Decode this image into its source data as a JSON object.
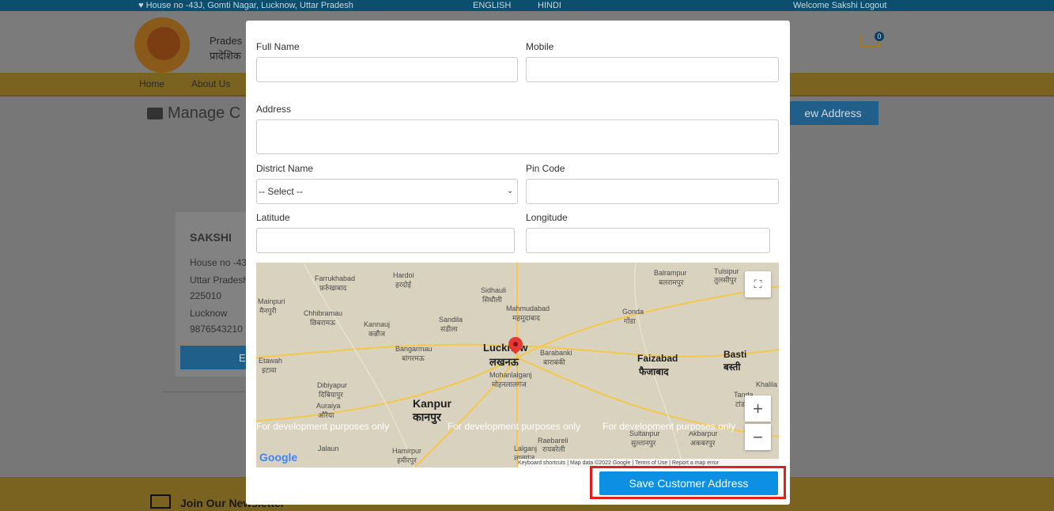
{
  "topbar": {
    "address": "♥ House no -43J, Gomti Nagar, Lucknow, Uttar Pradesh",
    "lang_english": "ENGLISH",
    "lang_hindi": "HINDI",
    "welcome": "Welcome Sakshi Logout"
  },
  "header": {
    "brand_en": "Prades",
    "brand_hi": "प्रादेशिक",
    "cart_count": "0"
  },
  "nav": {
    "items": [
      "Home",
      "About Us"
    ]
  },
  "page": {
    "title": "Manage C",
    "new_address_button": "ew Address"
  },
  "card": {
    "name": "SAKSHI",
    "lines": [
      "House no -43",
      "Uttar Pradesh",
      "225010",
      "Lucknow",
      "9876543210"
    ],
    "edit_label": "E"
  },
  "footer": {
    "newsletter": "Join Our Newsletter"
  },
  "modal": {
    "full_name_label": "Full Name",
    "mobile_label": "Mobile",
    "address_label": "Address",
    "district_label": "District Name",
    "district_selected": "-- Select --",
    "pin_label": "Pin Code",
    "latitude_label": "Latitude",
    "longitude_label": "Longitude",
    "save_button": "Save Customer Address"
  },
  "map": {
    "places": {
      "farrukhabad": "Farrukhabad",
      "farrukhabad_hi": "फ़र्रुखाबाद",
      "hardoi": "Hardoi",
      "hardoi_hi": "हरदोई",
      "sidhauli": "Sidhauli",
      "sidhauli_hi": "सिधौली",
      "mahmudabad": "Mahmudabad",
      "mahmudabad_hi": "महमूदाबाद",
      "balrampur": "Balrampur",
      "balrampur_hi": "बलरामपुर",
      "tulsipur": "Tulsipur",
      "tulsipur_hi": "तुलसीपुर",
      "mainpuri": "Mainpuri",
      "mainpuri_hi": "मैनपुरी",
      "chhibramau": "Chhibramau",
      "chhibramau_hi": "छिबरामऊ",
      "kannauj": "Kannauj",
      "kannauj_hi": "कन्नौज",
      "sandila": "Sandila",
      "sandila_hi": "संडीला",
      "gonda": "Gonda",
      "gonda_hi": "गोंडा",
      "lucknow": "Lucknow",
      "lucknow_hi": "लखनऊ",
      "bangarmau": "Bangarmau",
      "bangarmau_hi": "बांगरमऊ",
      "barabanki": "Barabanki",
      "barabanki_hi": "बाराबंकी",
      "mohanlalganj": "Mohanlalganj",
      "mohanlalganj_hi": "मोहनलालगंज",
      "faizabad": "Faizabad",
      "faizabad_hi": "फैजाबाद",
      "basti": "Basti",
      "basti_hi": "बस्ती",
      "etawah": "Etawah",
      "etawah_hi": "इटावा",
      "dibiyapur": "Dibiyapur",
      "dibiyapur_hi": "दिबियापुर",
      "auraiya": "Auraiya",
      "auraiya_hi": "औरैया",
      "kanpur": "Kanpur",
      "kanpur_hi": "कानपुर",
      "tanda": "Tanda",
      "tanda_hi": "टांडा",
      "khalilabad": "Khalila",
      "raebareli": "Raebareli",
      "raebareli_hi": "रायबरेली",
      "sultanpur": "Sultanpur",
      "sultanpur_hi": "सुल्तानपुर",
      "akbarpur": "Akbarpur",
      "akbarpur_hi": "अकबरपुर",
      "jalaun": "Jalaun",
      "hamirpur": "Hamirpur",
      "hamirpur_hi": "हमीरपुर",
      "lalganj": "Lalganj",
      "lalganj_hi": "लालगंज"
    },
    "dev_text": "For development purposes only",
    "google": "Google",
    "footer_text": "Keyboard shortcuts | Map data ©2022 Google | Terms of Use | Report a map error",
    "fullscreen_icon": "⛶",
    "zoom_in": "+",
    "zoom_out": "−"
  }
}
